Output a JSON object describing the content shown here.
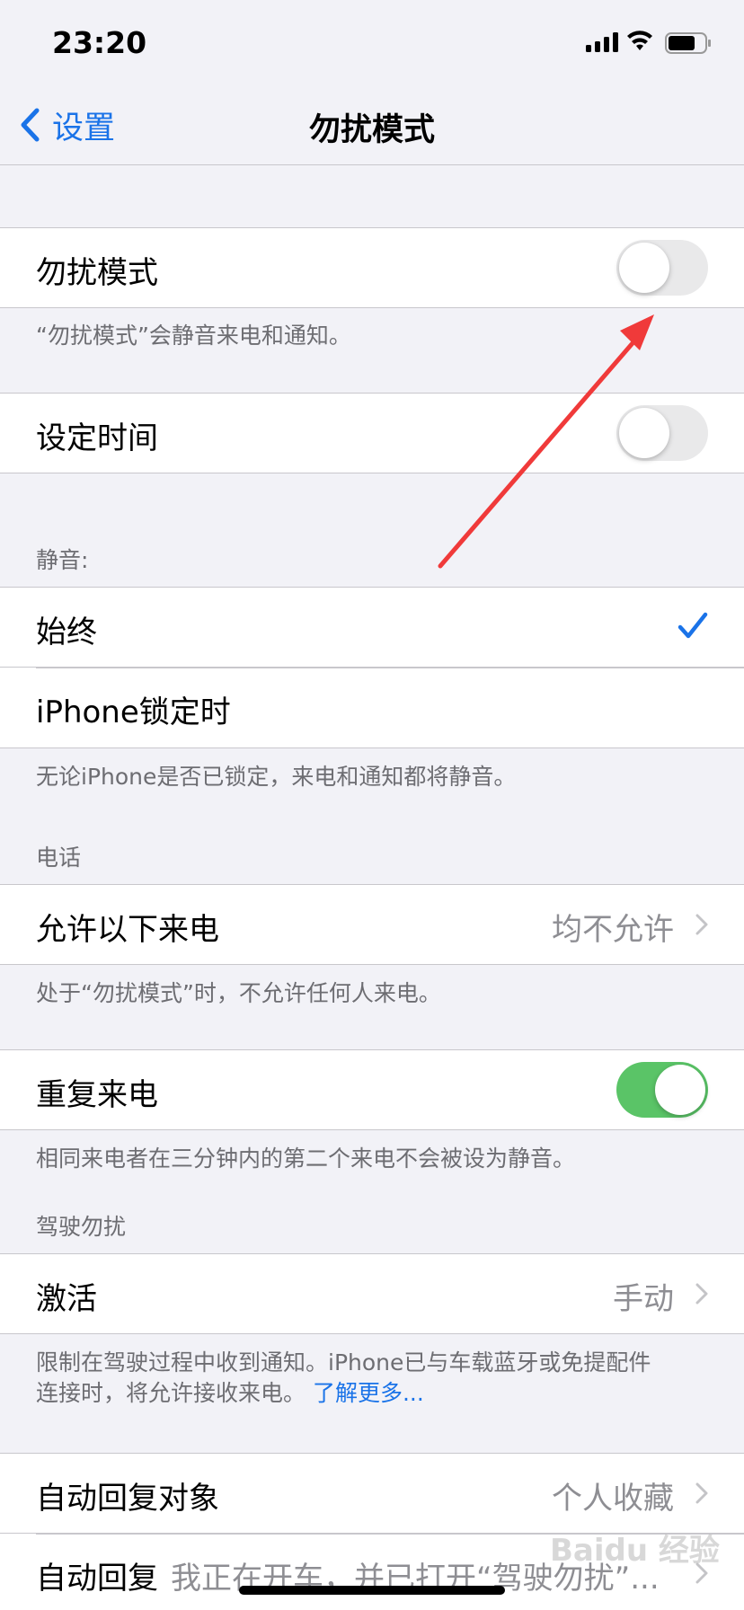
{
  "status_bar": {
    "time": "23:20"
  },
  "nav": {
    "back_label": "设置",
    "title": "勿扰模式"
  },
  "dnd": {
    "label": "勿扰模式",
    "footer": "“勿扰模式”会静音来电和通知。"
  },
  "scheduled": {
    "label": "设定时间"
  },
  "silence": {
    "header": "静音:",
    "always_label": "始终",
    "locked_label": "iPhone锁定时",
    "footer": "无论iPhone是否已锁定，来电和通知都将静音。"
  },
  "phone": {
    "header": "电话",
    "allow_calls_label": "允许以下来电",
    "allow_calls_value": "均不允许",
    "footer": "处于“勿扰模式”时，不允许任何人来电。",
    "repeated_label": "重复来电",
    "repeated_footer": "相同来电者在三分钟内的第二个来电不会被设为静音。"
  },
  "driving": {
    "header": "驾驶勿扰",
    "activate_label": "激活",
    "activate_value": "手动",
    "footer_line1": "限制在驾驶过程中收到通知。iPhone已与车载蓝牙或免提配件",
    "footer_line2": "连接时，将允许接收来电。",
    "learn_more": "了解更多...",
    "auto_reply_to_label": "自动回复对象",
    "auto_reply_to_value": "个人收藏",
    "auto_reply_label": "自动回复",
    "auto_reply_value": "我正在开车，并已打开“驾驶勿扰”..."
  },
  "watermark": "Baidu 经验",
  "toggles": {
    "dnd_on": false,
    "scheduled_on": false,
    "repeated_on": true
  },
  "colors": {
    "accent": "#1a73e8",
    "toggle_on": "#5ac467",
    "arrow": "#f03a3a"
  }
}
